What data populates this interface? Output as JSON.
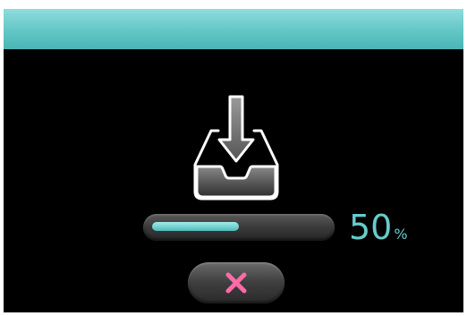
{
  "window": {
    "header_color": "#63c6c6",
    "background_color": "#000000"
  },
  "download": {
    "icon": "download-tray-icon",
    "progress_fraction": 0.5,
    "progress_value": "50",
    "progress_unit": "%",
    "accent_color": "#66cccc"
  },
  "cancel": {
    "icon": "close-icon",
    "icon_color": "#ff6aa8"
  }
}
